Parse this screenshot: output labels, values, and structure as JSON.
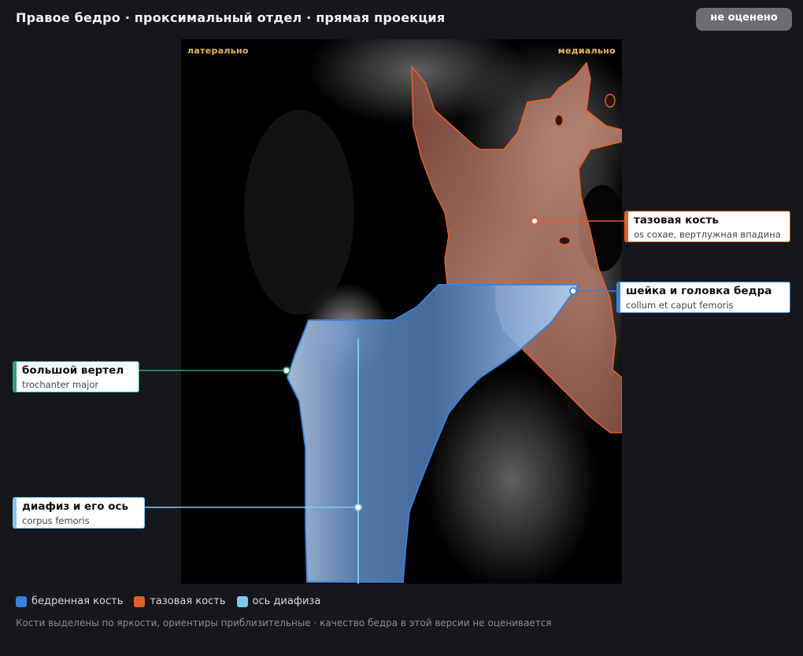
{
  "header": {
    "title": "Правое бедро · проксимальный отдел · прямая проекция",
    "status_badge": "не оценено"
  },
  "viewer": {
    "orientation_left": "латерально",
    "orientation_right": "медиально"
  },
  "callouts": {
    "pelvis": {
      "main": "тазовая кость",
      "sub": "os coxae, вертлужная впадина",
      "color": "#e0602c"
    },
    "neck": {
      "main": "шейка и головка бедра",
      "sub": "collum et caput femoris",
      "color": "#3a82db"
    },
    "trochanter": {
      "main": "большой вертел",
      "sub": "trochanter major",
      "color": "#2aa37a"
    },
    "shaft": {
      "main": "диафиз и его ось",
      "sub": "corpus femoris",
      "color": "#7cc8f0"
    }
  },
  "legend": {
    "femur": {
      "label": "бедренная кость",
      "color": "#3a82db"
    },
    "pelvis": {
      "label": "тазовая кость",
      "color": "#e0602c"
    },
    "axis": {
      "label": "ось диафиза",
      "color": "#7cc8f0"
    }
  },
  "footnote": "Кости выделены по яркости, ориентиры приблизительные · качество бедра в этой версии не оценивается"
}
